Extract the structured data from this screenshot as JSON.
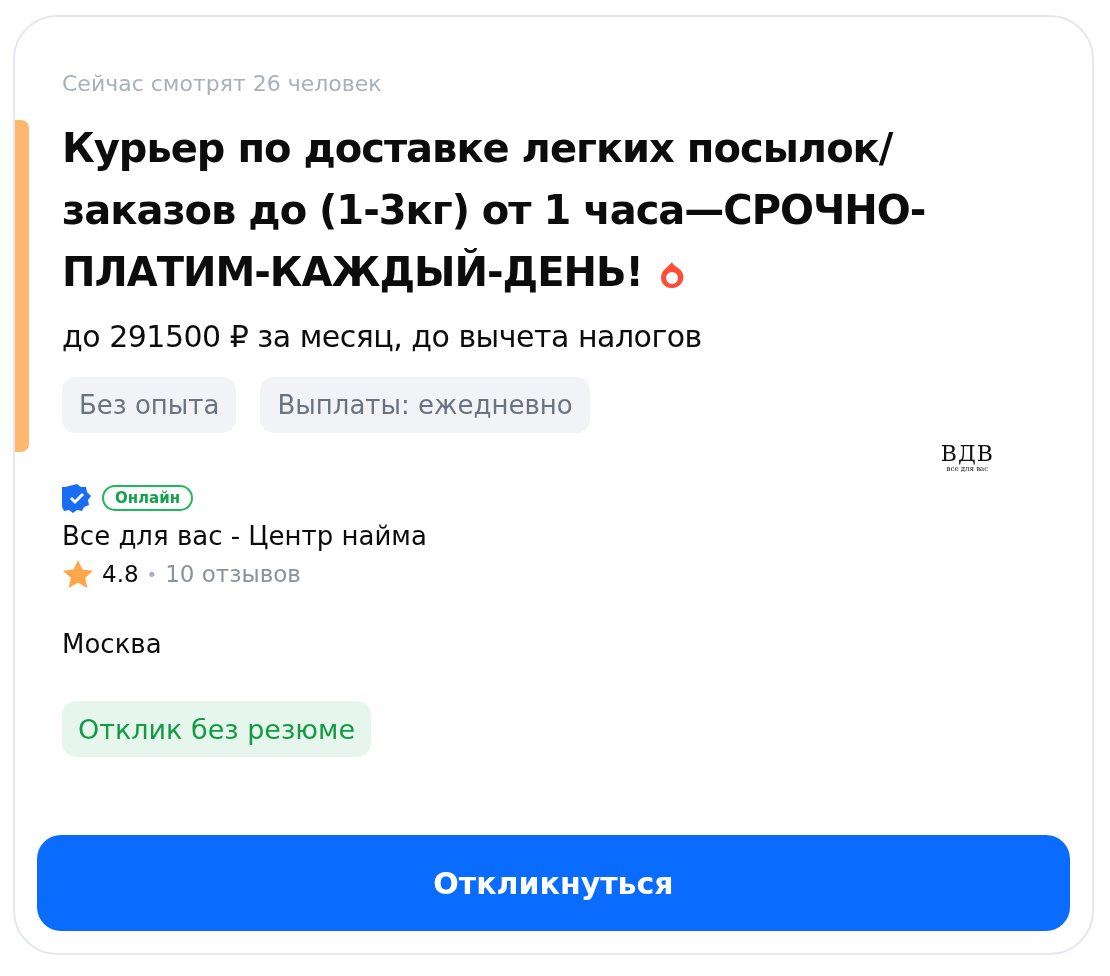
{
  "viewers": "Сейчас смотрят 26 человек",
  "title": "Курьер по доставке легких посылок/ заказов до (1-3кг) от 1 часа—СРОЧНО-ПЛАТИМ-КАЖДЫЙ-ДЕНЬ!",
  "hot": true,
  "salary": "до 291500 ₽ за месяц, до вычета налогов",
  "tags": [
    "Без опыта",
    "Выплаты: ежедневно"
  ],
  "employer": {
    "verified": true,
    "status": "Онлайн",
    "name": "Все для вас - Центр найма",
    "rating": "4.8",
    "separator": "•",
    "reviews": "10 отзывов",
    "logo": {
      "mark": "ВДВ",
      "tagline": "все для вас"
    }
  },
  "city": "Москва",
  "badge": "Отклик без резюме",
  "button": "Откликнуться"
}
